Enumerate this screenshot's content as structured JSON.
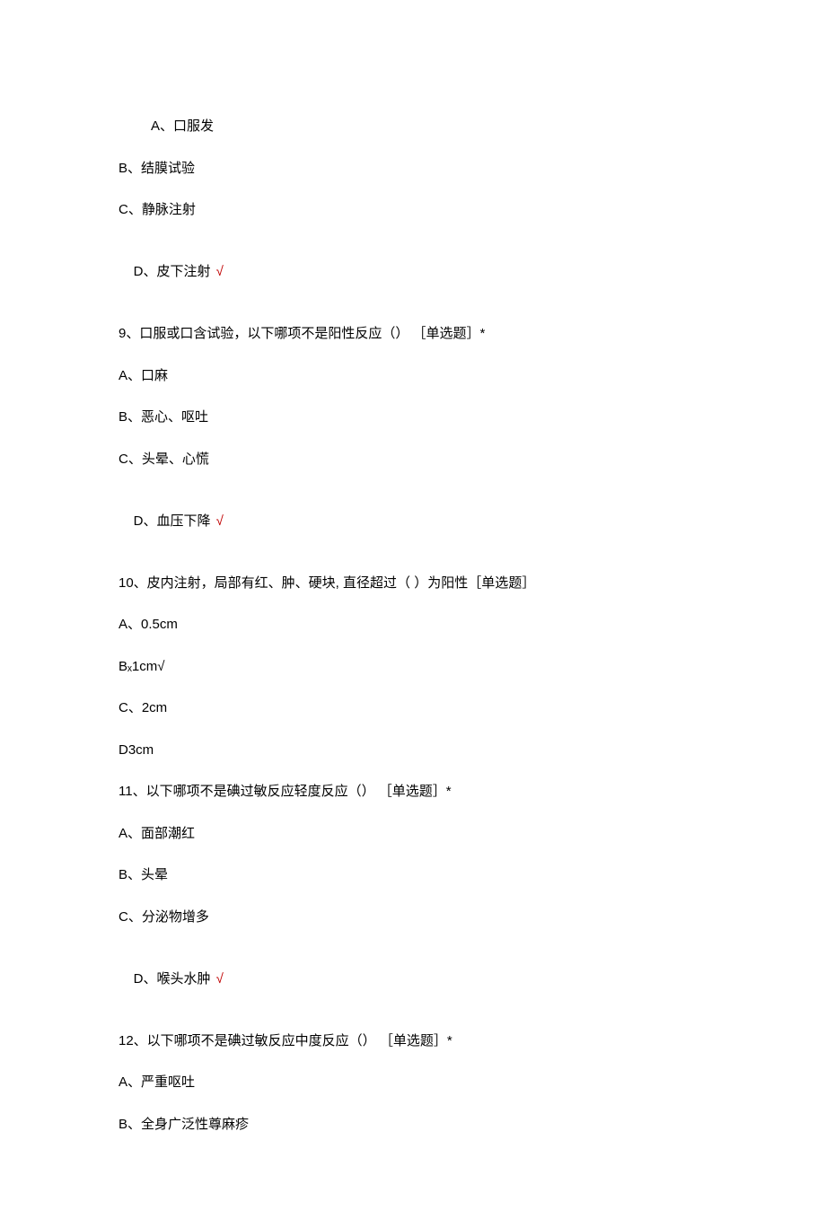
{
  "opt_A": "A、口服发",
  "opt_B1": "B、结膜试验",
  "opt_C1": "C、静脉注射",
  "opt_D1_text": "D、皮下注射",
  "check": " √",
  "q9": "9、口服或口含试验，以下哪项不是阳性反应（） ［单选题］*",
  "q9_A": "A、口麻",
  "q9_B": "B、恶心、呕吐",
  "q9_C": "C、头晕、心慌",
  "q9_D_text": "D、血压下降",
  "q10": "10、皮内注射，局部有红、肿、硬块, 直径超过（ ）为阳性［单选题］",
  "q10_A": "A、0.5cm",
  "q10_B": "Bₓ1cm√",
  "q10_C": "C、2cm",
  "q10_D": "D3cm",
  "q11": "11、以下哪项不是碘过敏反应轻度反应（） ［单选题］*",
  "q11_A": "A、面部潮红",
  "q11_B": "B、头晕",
  "q11_C": "C、分泌物增多",
  "q11_D_text": "D、喉头水肿",
  "q12": "12、以下哪项不是碘过敏反应中度反应（） ［单选题］*",
  "q12_A": "A、严重呕吐",
  "q12_B": "B、全身广泛性尊麻疹"
}
